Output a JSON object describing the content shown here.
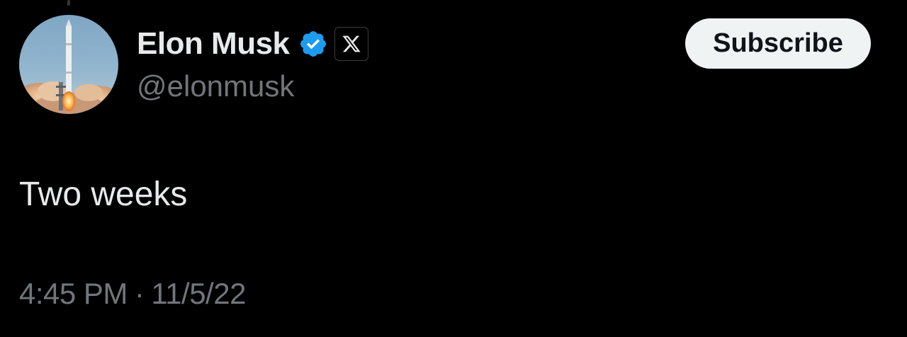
{
  "author": {
    "display_name": "Elon Musk",
    "handle": "@elonmusk",
    "verified": true,
    "affiliate_badge_icon": "x-logo-icon",
    "avatar_icon": "rocket-launch-avatar"
  },
  "actions": {
    "subscribe_label": "Subscribe"
  },
  "tweet": {
    "text": "Two weeks",
    "time": "4:45 PM",
    "separator": "·",
    "date": "11/5/22"
  },
  "colors": {
    "background": "#000000",
    "primary_text": "#e7e9ea",
    "secondary_text": "#71767b",
    "verified_blue": "#1d9bf0",
    "button_bg": "#eff3f4"
  }
}
